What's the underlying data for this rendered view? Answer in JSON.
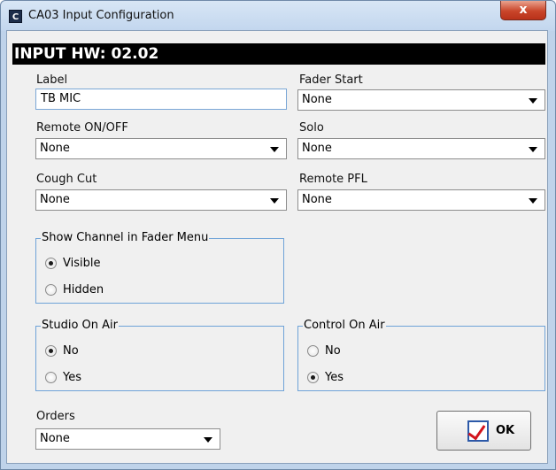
{
  "window": {
    "title": "CA03 Input Configuration",
    "app_icon": "C",
    "close_glyph": "x"
  },
  "header": {
    "text": "INPUT HW: 02.02"
  },
  "label_field": {
    "caption": "Label",
    "value": "TB MIC"
  },
  "fader_start": {
    "caption": "Fader Start",
    "value": "None"
  },
  "remote_onoff": {
    "caption": "Remote ON/OFF",
    "value": "None"
  },
  "solo": {
    "caption": "Solo",
    "value": "None"
  },
  "cough_cut": {
    "caption": "Cough Cut",
    "value": "None"
  },
  "remote_pfl": {
    "caption": "Remote PFL",
    "value": "None"
  },
  "show_channel": {
    "title": "Show Channel in Fader Menu",
    "options": [
      {
        "label": "Visible",
        "checked": true
      },
      {
        "label": "Hidden",
        "checked": false
      }
    ]
  },
  "studio_on_air": {
    "title": "Studio On Air",
    "options": [
      {
        "label": "No",
        "checked": true
      },
      {
        "label": "Yes",
        "checked": false
      }
    ]
  },
  "control_on_air": {
    "title": "Control On Air",
    "options": [
      {
        "label": "No",
        "checked": false
      },
      {
        "label": "Yes",
        "checked": true
      }
    ]
  },
  "orders": {
    "caption": "Orders",
    "value": "None"
  },
  "ok_button": {
    "label": "OK",
    "icon": "checkmark-icon"
  },
  "colors": {
    "titlebar": "#c2d6ee",
    "client_bg": "#f0f0f0",
    "header_bg": "#000000",
    "group_border": "#6fa3d8",
    "close_button": "#c9452a",
    "check_red": "#d2141c"
  }
}
